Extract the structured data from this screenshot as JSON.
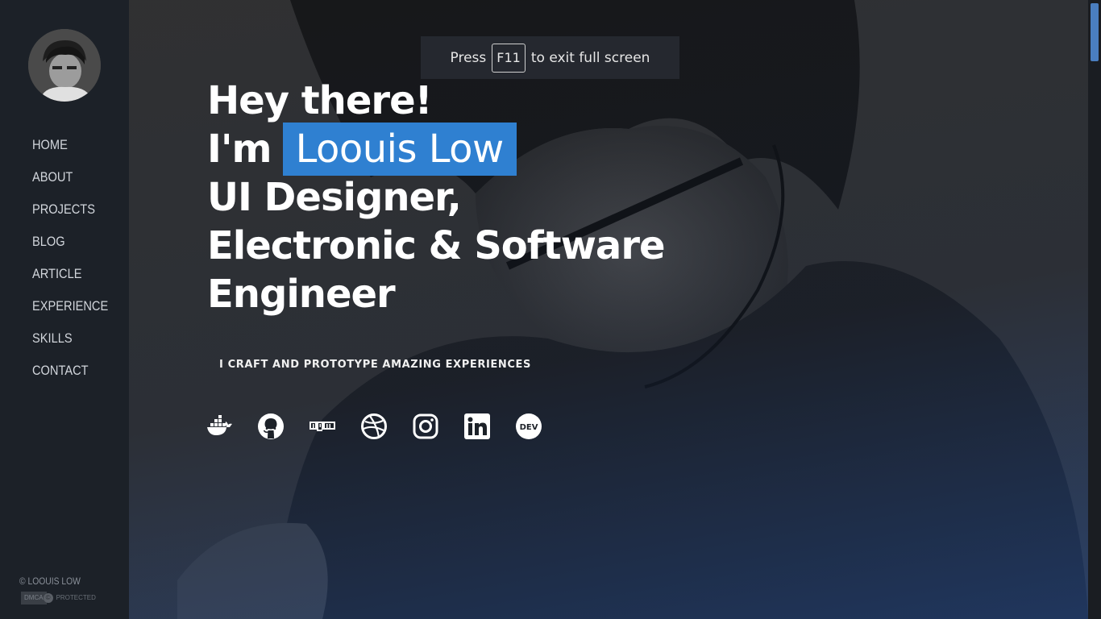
{
  "sidebar": {
    "nav": [
      {
        "label": "HOME"
      },
      {
        "label": "ABOUT"
      },
      {
        "label": "PROJECTS"
      },
      {
        "label": "BLOG"
      },
      {
        "label": "ARTICLE"
      },
      {
        "label": "EXPERIENCE"
      },
      {
        "label": "SKILLS"
      },
      {
        "label": "CONTACT"
      }
    ],
    "copyright": "© LOOUIS LOW",
    "dmca": {
      "left": "DMCA",
      "right": "PROTECTED"
    }
  },
  "fullscreen_hint": {
    "before": "Press",
    "key": "F11",
    "after": "to exit full screen"
  },
  "hero": {
    "greeting": "Hey there!",
    "im": "I'm",
    "name": "Loouis Low",
    "role_line1": "UI Designer,",
    "role_line2": "Electronic & Software",
    "role_line3": "Engineer",
    "tagline": "I CRAFT AND PROTOTYPE AMAZING EXPERIENCES"
  },
  "socials": [
    {
      "icon": "docker-icon"
    },
    {
      "icon": "github-icon"
    },
    {
      "icon": "npm-icon"
    },
    {
      "icon": "dribbble-icon"
    },
    {
      "icon": "instagram-icon"
    },
    {
      "icon": "linkedin-icon"
    },
    {
      "icon": "dev-icon",
      "label": "DEV"
    }
  ],
  "colors": {
    "sidebar_bg": "#1c2128",
    "name_highlight": "#2f80d1",
    "scroll_thumb": "#4a7ec0"
  }
}
